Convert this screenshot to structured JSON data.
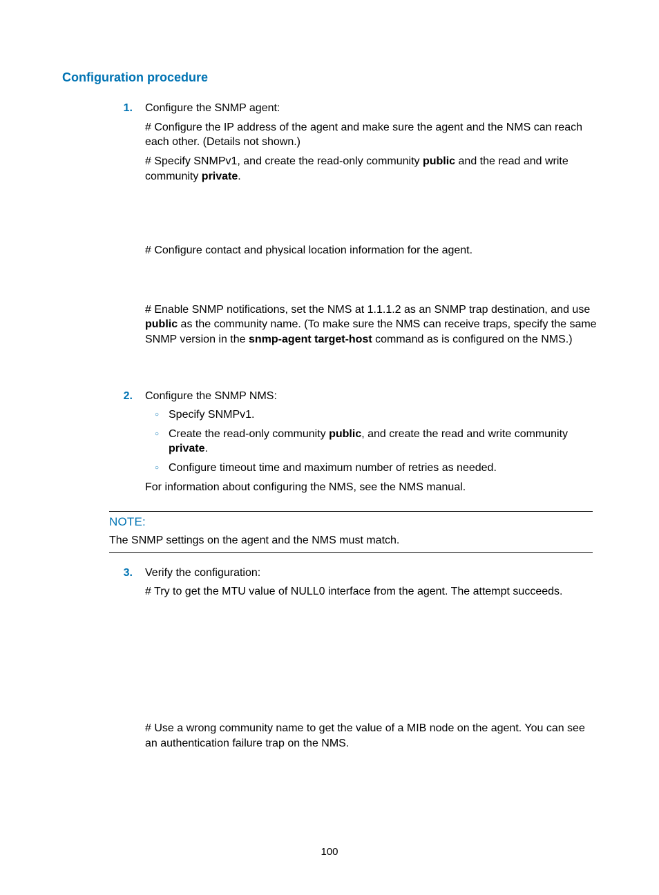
{
  "heading": "Configuration procedure",
  "steps": [
    {
      "num": "1.",
      "title": "Configure the SNMP agent:",
      "p1": "# Configure the IP address of the agent and make sure the agent and the NMS can reach each other. (Details not shown.)",
      "p2_a": "# Specify SNMPv1, and create the read-only community ",
      "p2_b1": "public",
      "p2_c": " and the read and write community ",
      "p2_b2": "private",
      "p2_d": ".",
      "p3": "# Configure contact and physical location information for the agent.",
      "p4_a": "# Enable SNMP notifications, set the NMS at 1.1.1.2 as an SNMP trap destination, and use ",
      "p4_b1": "public",
      "p4_c": " as the community name. (To make sure the NMS can receive traps, specify the same SNMP version in the ",
      "p4_b2": "snmp-agent target-host",
      "p4_d": " command as is configured on the NMS.)"
    },
    {
      "num": "2.",
      "title": "Configure the SNMP NMS:",
      "s1": "Specify SNMPv1.",
      "s2_a": "Create the read-only community ",
      "s2_b1": "public",
      "s2_c": ", and create the read and write community ",
      "s2_b2": "private",
      "s2_d": ".",
      "s3": "Configure timeout time and maximum number of retries as needed.",
      "after": "For information about configuring the NMS, see the NMS manual."
    },
    {
      "num": "3.",
      "title": "Verify the configuration:",
      "p1": "# Try to get the MTU value of NULL0 interface from the agent. The attempt succeeds.",
      "p2": "# Use a wrong community name to get the value of a MIB node on the agent. You can see an authentication failure trap on the NMS."
    }
  ],
  "note": {
    "label": "NOTE:",
    "body": "The SNMP settings on the agent and the NMS must match."
  },
  "page_number": "100"
}
